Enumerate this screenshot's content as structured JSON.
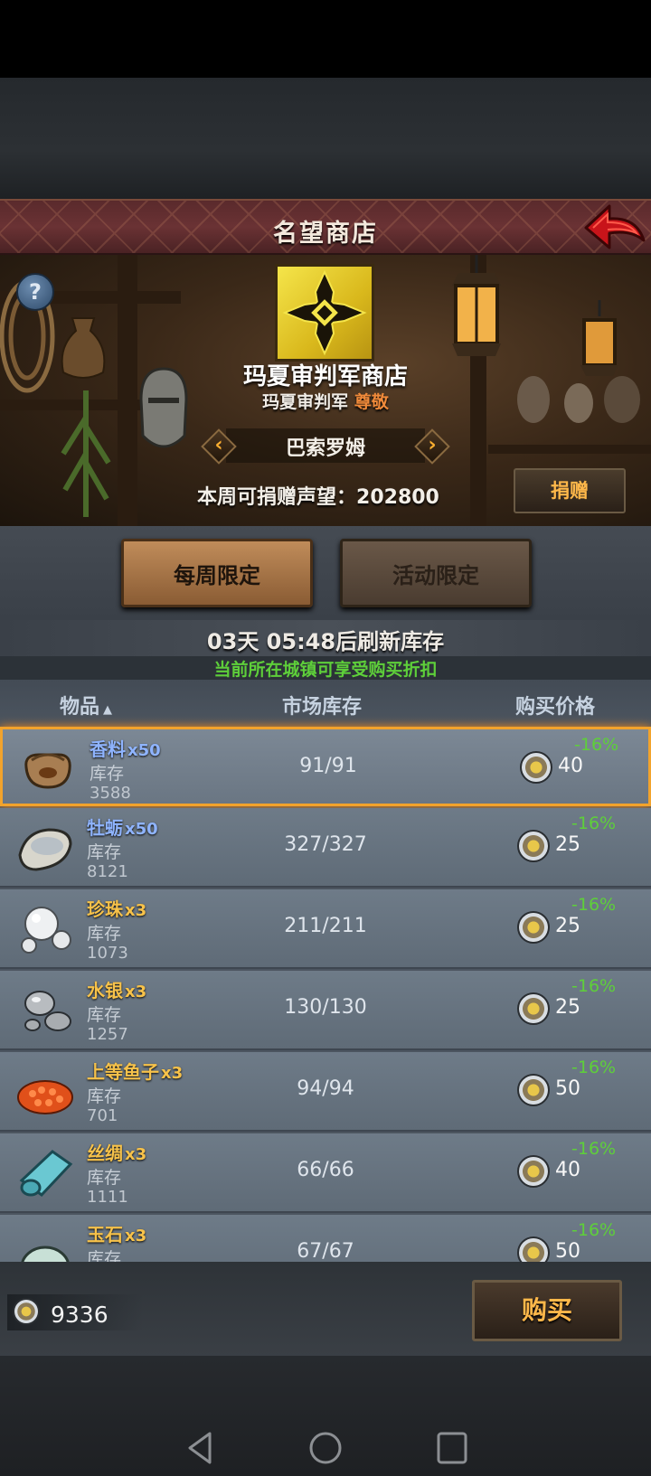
{
  "header": {
    "title": "名望商店"
  },
  "shop": {
    "name": "玛夏审判军商店",
    "faction": "玛夏审判军",
    "reputation": "尊敬",
    "town": "巴索罗姆",
    "donate_label": "本周可捐赠声望：",
    "donate_value": "202800",
    "donate_button": "捐赠"
  },
  "tabs": {
    "weekly": "每周限定",
    "event": "活动限定"
  },
  "refresh": {
    "days": "03",
    "days_unit": "天",
    "time": "05:48",
    "suffix": "后刷新库存"
  },
  "discount_note": "当前所在城镇可享受购买折扣",
  "columns": {
    "item": "物品",
    "stock": "市场库存",
    "price": "购买价格"
  },
  "stock_label": "库存",
  "items": [
    {
      "name": "香料",
      "qty": "x50",
      "stock": "3588",
      "market": "91/91",
      "price": "40",
      "discount": "-16%"
    },
    {
      "name": "牡蛎",
      "qty": "x50",
      "stock": "8121",
      "market": "327/327",
      "price": "25",
      "discount": "-16%"
    },
    {
      "name": "珍珠",
      "qty": "x3",
      "stock": "1073",
      "market": "211/211",
      "price": "25",
      "discount": "-16%"
    },
    {
      "name": "水银",
      "qty": "x3",
      "stock": "1257",
      "market": "130/130",
      "price": "25",
      "discount": "-16%"
    },
    {
      "name": "上等鱼子",
      "qty": "x3",
      "stock": "701",
      "market": "94/94",
      "price": "50",
      "discount": "-16%"
    },
    {
      "name": "丝绸",
      "qty": "x3",
      "stock": "1111",
      "market": "66/66",
      "price": "40",
      "discount": "-16%"
    },
    {
      "name": "玉石",
      "qty": "x3",
      "stock": "",
      "market": "67/67",
      "price": "50",
      "discount": "-16%"
    }
  ],
  "footer": {
    "currency": "9336",
    "buy_button": "购买"
  },
  "colors": {
    "accent": "#f2a32c",
    "discount": "#5ecf3a",
    "gold_text": "#f7c24a",
    "blue_text": "#8fb4ff"
  }
}
